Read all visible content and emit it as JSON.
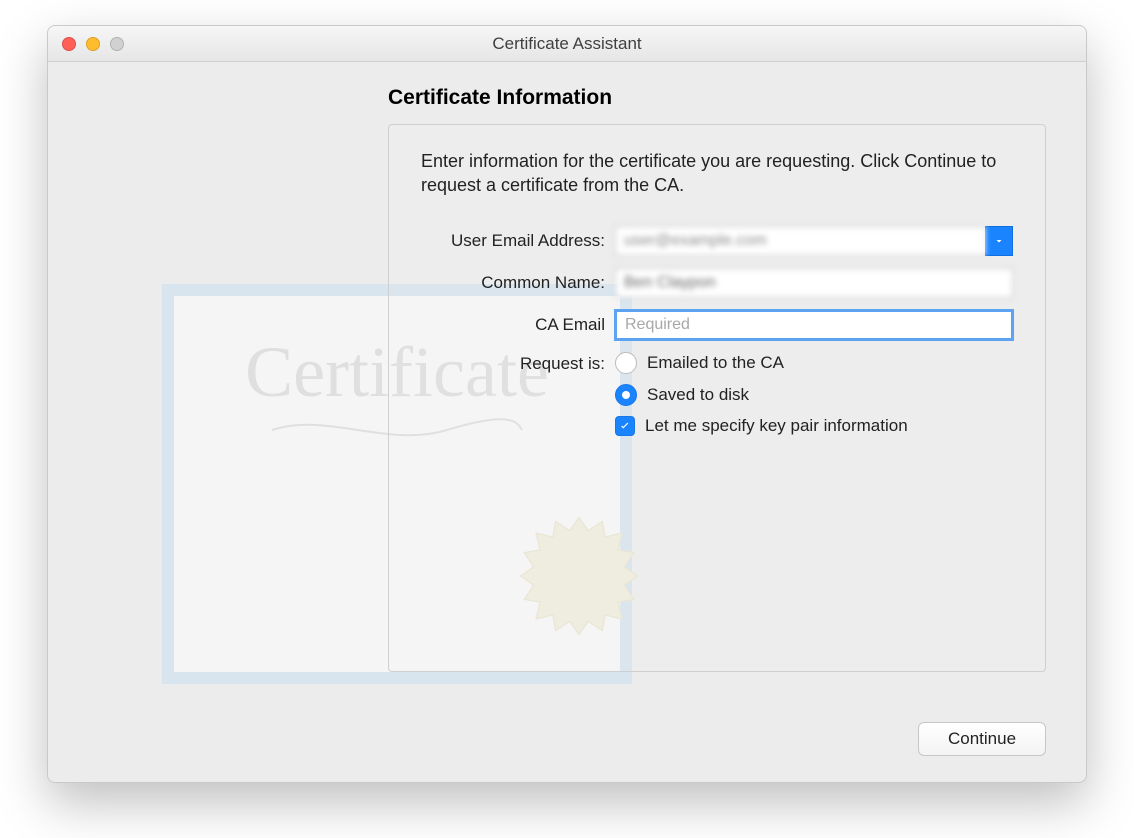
{
  "window": {
    "title": "Certificate Assistant"
  },
  "page": {
    "heading": "Certificate Information",
    "instructions": "Enter information for the certificate you are requesting. Click Continue to request a certificate from the CA."
  },
  "fields": {
    "email_label": "User Email Address:",
    "email_value": "user@example.com",
    "common_name_label": "Common Name:",
    "common_name_value": "Ben Claypon",
    "ca_email_label": "CA Email",
    "ca_email_value": "",
    "ca_email_placeholder": "Required",
    "request_label": "Request is:"
  },
  "options": {
    "emailed_label": "Emailed to the CA",
    "emailed_selected": false,
    "saved_label": "Saved to disk",
    "saved_selected": true,
    "keypair_label": "Let me specify key pair information",
    "keypair_checked": true
  },
  "buttons": {
    "continue": "Continue"
  }
}
